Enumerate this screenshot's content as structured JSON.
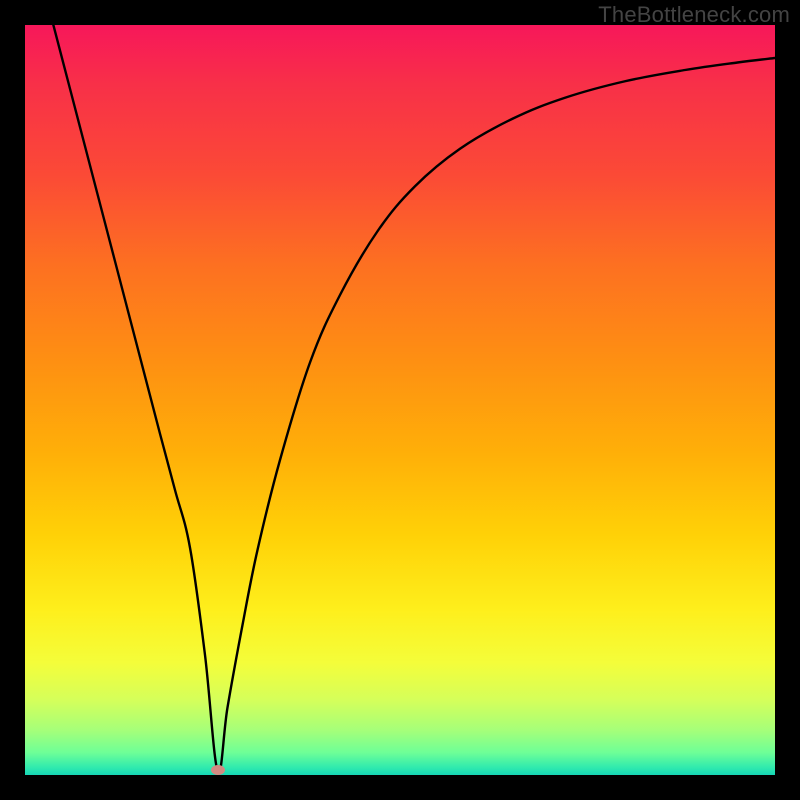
{
  "watermark": "TheBottleneck.com",
  "chart_data": {
    "type": "line",
    "title": "",
    "xlabel": "",
    "ylabel": "",
    "xlim": [
      0,
      100
    ],
    "ylim": [
      0,
      100
    ],
    "grid": false,
    "legend": false,
    "background_gradient": {
      "orientation": "vertical",
      "stops": [
        {
          "pos": 0.0,
          "color": "#f7175a"
        },
        {
          "pos": 0.2,
          "color": "#fb4a36"
        },
        {
          "pos": 0.45,
          "color": "#fe9012"
        },
        {
          "pos": 0.68,
          "color": "#ffd107"
        },
        {
          "pos": 0.85,
          "color": "#f4fd3a"
        },
        {
          "pos": 0.97,
          "color": "#6eff97"
        },
        {
          "pos": 1.0,
          "color": "#16d6b6"
        }
      ]
    },
    "series": [
      {
        "name": "curve",
        "x": [
          3,
          6,
          9,
          12,
          15,
          18,
          20,
          22,
          24,
          25.7,
          27,
          29,
          31,
          34,
          38,
          42,
          47,
          52,
          58,
          65,
          72,
          80,
          88,
          95,
          100
        ],
        "y": [
          103,
          91.5,
          80,
          68.5,
          57,
          45.5,
          38,
          30.3,
          16,
          0.5,
          9,
          20,
          30,
          42,
          55,
          64,
          72.5,
          78.5,
          83.5,
          87.5,
          90.3,
          92.5,
          94,
          95,
          95.6
        ]
      }
    ],
    "marker": {
      "name": "min-dot",
      "x": 25.7,
      "y": 0.7,
      "color": "#d28a82"
    }
  }
}
